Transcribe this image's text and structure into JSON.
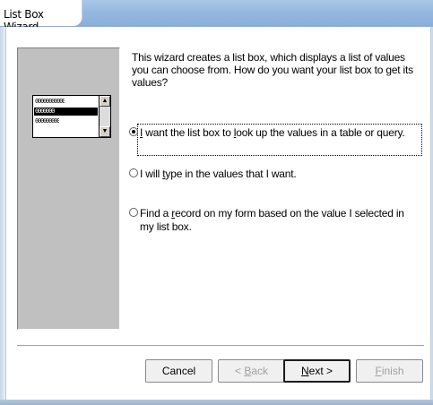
{
  "window": {
    "title": "List Box Wizard"
  },
  "illustration": {
    "rows": [
      "00000000000",
      "0000000",
      "000000000"
    ]
  },
  "description": "This wizard creates a list box, which displays a list of values you can choose from.  How do you want your list box to get its values?",
  "options": [
    {
      "pre": "",
      "mnemonic": "I",
      "post": " want the list box to ",
      "mnemonic2": "l",
      "post2": "ook up the values in a table or query.",
      "checked": true
    },
    {
      "pre": "I will ",
      "mnemonic": "t",
      "post": "ype in the values that I want.",
      "checked": false
    },
    {
      "pre": "Find a ",
      "mnemonic": "r",
      "post": "ecord on my form based on the value I selected in my list box.",
      "checked": false
    }
  ],
  "buttons": {
    "cancel": {
      "label": "Cancel"
    },
    "back": {
      "pre": "< ",
      "mnemonic": "B",
      "post": "ack",
      "enabled": false
    },
    "next": {
      "pre": "",
      "mnemonic": "N",
      "post": "ext >",
      "enabled": true
    },
    "finish": {
      "pre": "",
      "mnemonic": "F",
      "post": "inish",
      "enabled": false
    }
  },
  "colors": {
    "titlebar": "#95b8df",
    "panel": "#c0c0c0"
  }
}
